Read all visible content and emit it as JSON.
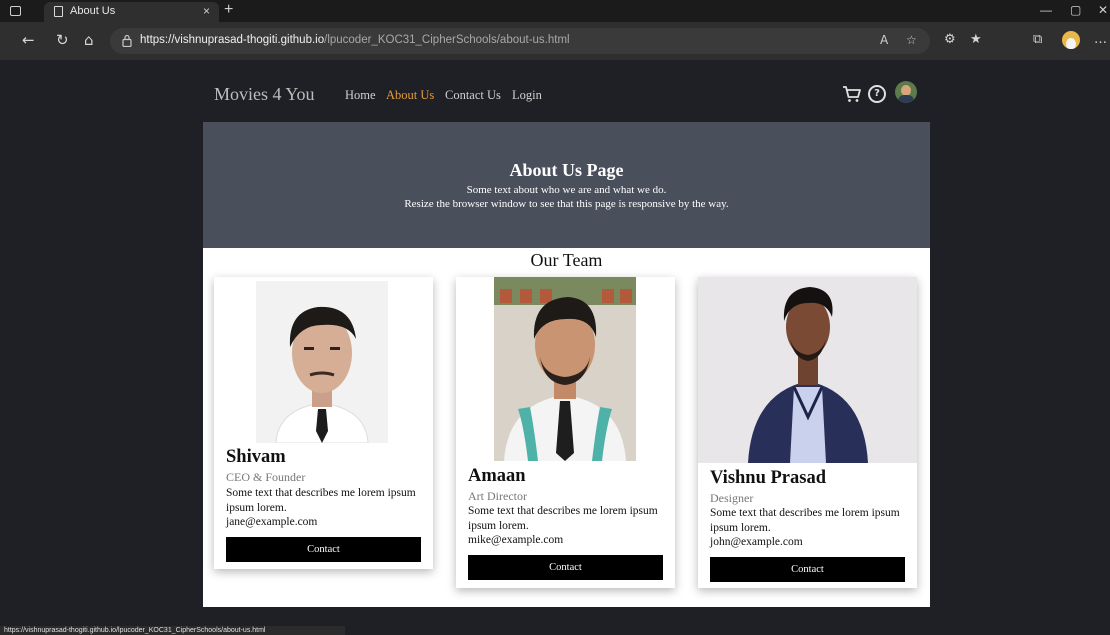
{
  "browser": {
    "tab_title": "About Us",
    "tab_close": "×",
    "new_tab": "+",
    "url_domain": "https://vishnuprasad-thogiti.github.io",
    "url_path": "/lpucoder_KOC31_CipherSchools/about-us.html",
    "status_url": "https://vishnuprasad-thogiti.github.io/lpucoder_KOC31_CipherSchools/about-us.html",
    "icons": [
      "window-menu-icon",
      "page-icon",
      "back-icon",
      "refresh-icon",
      "home-icon",
      "lock-icon",
      "read-aloud-icon",
      "favorite-add-icon",
      "extensions-icon",
      "favorites-icon",
      "collections-icon",
      "profile-icon",
      "more-icon"
    ]
  },
  "site": {
    "brand": "Movies 4 You",
    "nav": [
      "Home",
      "About Us",
      "Contact Us",
      "Login"
    ],
    "active_nav": "About Us",
    "accent_color": "#e39b3b"
  },
  "hero": {
    "title": "About Us Page",
    "line1": "Some text about who we are and what we do.",
    "line2": "Resize the browser window to see that this page is responsive by the way.",
    "bg_color": "#4a4f5c"
  },
  "team": {
    "heading": "Our Team",
    "members": [
      {
        "name": "Shivam",
        "title": "CEO & Founder",
        "description": "Some text that describes me lorem ipsum ipsum lorem.",
        "email": "jane@example.com",
        "button": "Contact"
      },
      {
        "name": "Amaan",
        "title": "Art Director",
        "description": "Some text that describes me lorem ipsum ipsum lorem.",
        "email": "mike@example.com",
        "button": "Contact"
      },
      {
        "name": "Vishnu Prasad",
        "title": "Designer",
        "description": "Some text that describes me lorem ipsum ipsum lorem.",
        "email": "john@example.com",
        "button": "Contact"
      }
    ]
  }
}
